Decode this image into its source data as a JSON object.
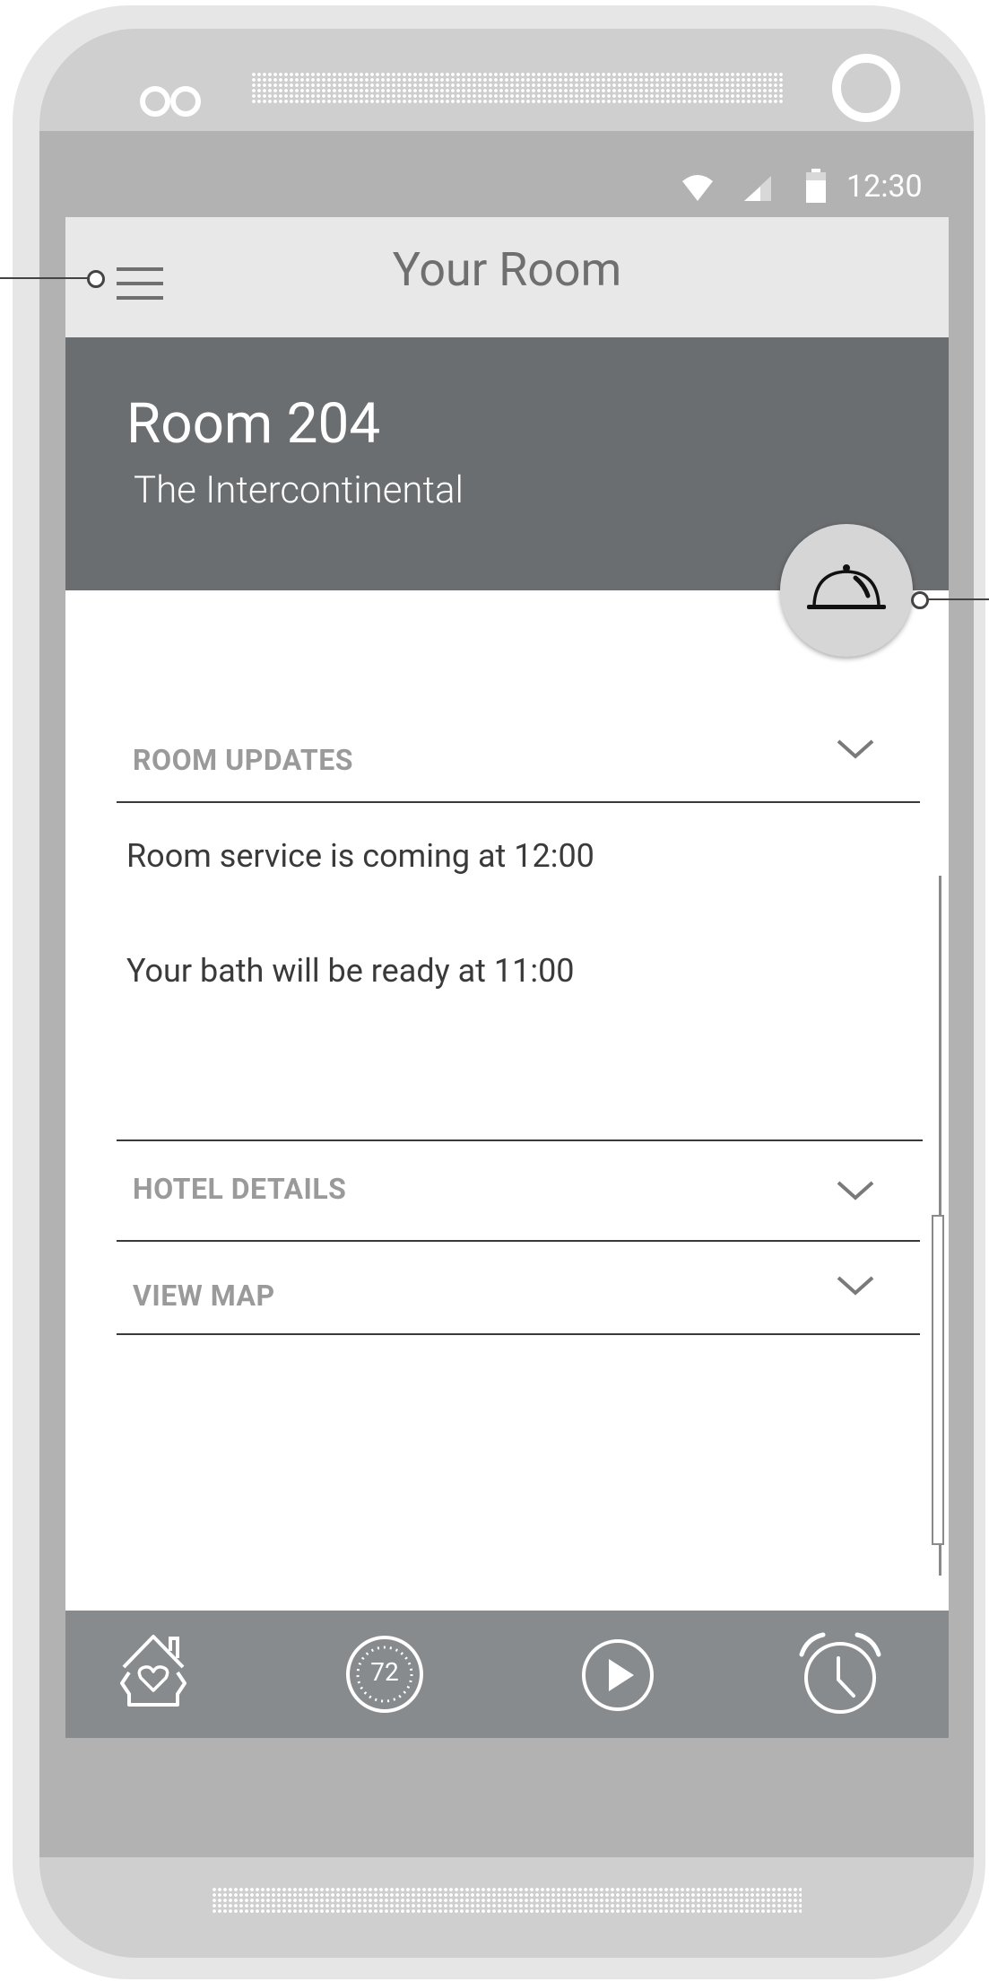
{
  "status_bar": {
    "time": "12:30"
  },
  "appbar": {
    "title": "Your Room"
  },
  "header": {
    "room": "Room 204",
    "hotel": "The Intercontinental"
  },
  "sections": {
    "room_updates": {
      "label": "ROOM UPDATES",
      "items": [
        "Room service is coming at 12:00",
        "Your bath will be ready at 11:00"
      ]
    },
    "hotel_details": {
      "label": "HOTEL DETAILS"
    },
    "view_map": {
      "label": "VIEW MAP"
    }
  },
  "bottom_nav": {
    "items": [
      {
        "icon": "home-heart-icon"
      },
      {
        "icon": "thermostat-icon",
        "value": "72"
      },
      {
        "icon": "play-icon"
      },
      {
        "icon": "alarm-clock-icon"
      }
    ]
  },
  "icons": {
    "fab": "room-service-bell-icon",
    "menu": "hamburger-menu-icon"
  },
  "colors": {
    "header": "#6b6e71",
    "appbar": "#e8e8e8",
    "bottom_nav": "#878b8e",
    "fab": "#d6d6d6"
  }
}
